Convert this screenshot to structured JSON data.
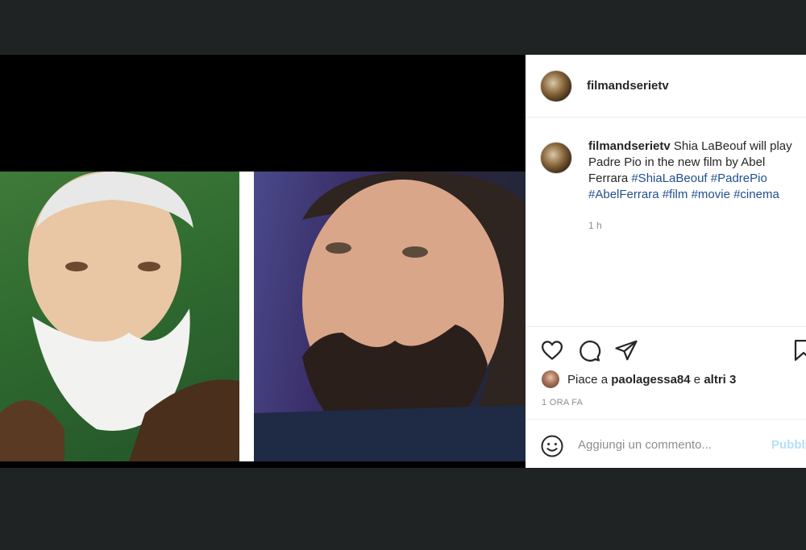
{
  "post": {
    "username": "filmandserietv",
    "caption_user": "filmandserietv",
    "caption_text": " Shia LaBeouf will play Padre Pio in the new film by Abel Ferrara ",
    "hashtags": [
      "#ShiaLaBeouf",
      "#PadrePio",
      "#AbelFerrara",
      "#film",
      "#movie",
      "#cinema"
    ],
    "time": "1 h",
    "likes_prefix": "Piace a ",
    "likes_user": "paolagessa84",
    "likes_mid": " e ",
    "likes_others": "altri 3",
    "time_ago": "1 ORA FA",
    "comment_placeholder": "Aggiungi un commento...",
    "post_button": "Pubblica"
  },
  "icons": [
    "heart-icon",
    "comment-icon",
    "share-icon",
    "bookmark-icon",
    "emoji-icon"
  ],
  "colors": {
    "background": "#202324",
    "hashtag": "#1f4f8f",
    "muted": "#8e8e8e",
    "post_button": "#b2dffc"
  }
}
